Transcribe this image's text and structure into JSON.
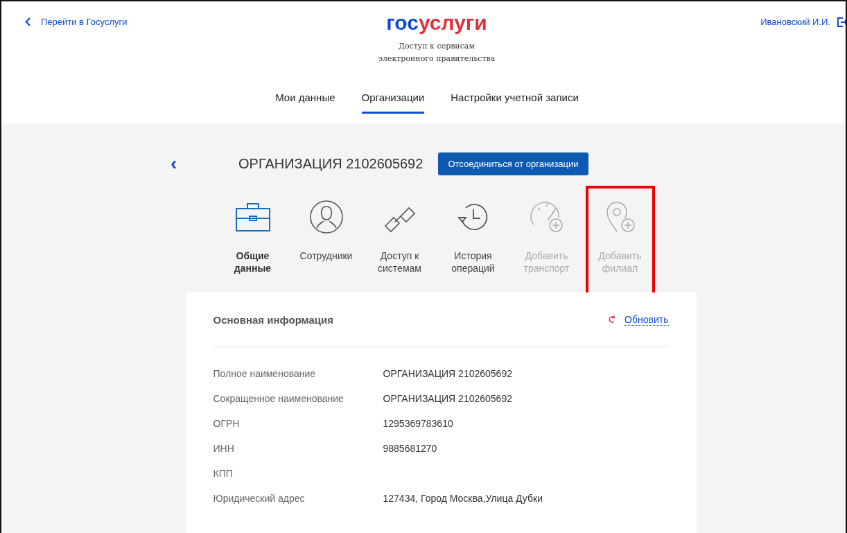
{
  "header": {
    "back_link": "Перейти в Госуслуги",
    "logo": {
      "part_1": "гос",
      "part_2": "услуги"
    },
    "subtitle_1": "Доступ к сервисам",
    "subtitle_2": "электронного правительства",
    "user": "Ивановский И.И."
  },
  "tabs": [
    {
      "label": "Мои данные",
      "selected": false
    },
    {
      "label": "Организации",
      "selected": true
    },
    {
      "label": "Настройки учетной записи",
      "selected": false
    }
  ],
  "organization": {
    "back": "‹",
    "title": "ОРГАНИЗАЦИЯ 2102605692",
    "disconnect_button": "Отсоединиться от организации"
  },
  "sections": [
    {
      "kind": "briefcase",
      "label_1": "Общие",
      "label_2": "данные",
      "selected": true,
      "disabled": false,
      "highlighted": false
    },
    {
      "kind": "person",
      "label_1": "Сотрудники",
      "selected": false,
      "disabled": false,
      "highlighted": false
    },
    {
      "kind": "link",
      "label_1": "Доступ к",
      "label_2": "системам",
      "selected": false,
      "disabled": false,
      "highlighted": false
    },
    {
      "kind": "history",
      "label_1": "История",
      "label_2": "операций",
      "selected": false,
      "disabled": false,
      "highlighted": false
    },
    {
      "kind": "gauge",
      "label_1": "Добавить",
      "label_2": "транспорт",
      "selected": false,
      "disabled": true,
      "highlighted": false
    },
    {
      "kind": "pin",
      "label_1": "Добавить",
      "label_2": "филиал",
      "selected": false,
      "disabled": true,
      "highlighted": true
    }
  ],
  "card": {
    "title": "Основная информация",
    "refresh": "Обновить",
    "rows": [
      {
        "label": "Полное наименование",
        "value": "ОРГАНИЗАЦИЯ 2102605692"
      },
      {
        "label": "Сокращенное наименование",
        "value": "ОРГАНИЗАЦИЯ 2102605692"
      },
      {
        "label": "ОГРН",
        "value": "1295369783610"
      },
      {
        "label": "ИНН",
        "value": "9885681270"
      },
      {
        "label": "КПП"
      },
      {
        "label": "Юридический адрес",
        "value": "127434, Город Москва,Улица Дубки"
      }
    ]
  }
}
